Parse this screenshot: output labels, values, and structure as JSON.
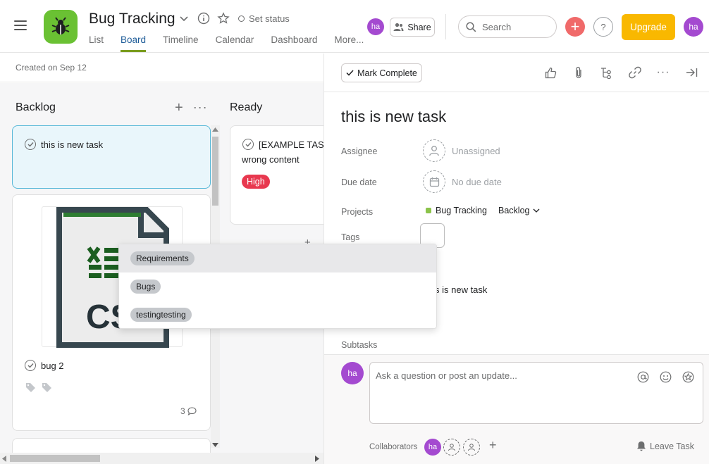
{
  "header": {
    "project_title": "Bug Tracking",
    "set_status": "Set status",
    "tabs": [
      "List",
      "Board",
      "Timeline",
      "Calendar",
      "Dashboard",
      "More..."
    ],
    "active_tab": "Board",
    "user_initials": "ha",
    "share_label": "Share",
    "search_placeholder": "Search",
    "help_label": "?",
    "upgrade_label": "Upgrade",
    "project_icon": "bug-icon",
    "colors": {
      "accent": "#6ac133",
      "upgrade": "#f9b800",
      "add": "#f06a6a",
      "avatar": "#a44ad0"
    }
  },
  "board": {
    "created": "Created on Sep 12",
    "columns": [
      {
        "title": "Backlog"
      },
      {
        "title": "Ready"
      }
    ],
    "backlog_cards": [
      {
        "title": "this is new task"
      },
      {
        "title": "bug 2",
        "comment_count": "3",
        "attachment_text": "CS"
      }
    ],
    "ready_cards": [
      {
        "title_line1": "[EXAMPLE TASK",
        "title_line2": "wrong content",
        "priority": "High",
        "priority_color": "#e8384f"
      }
    ]
  },
  "tag_dropdown": {
    "options": [
      "Requirements",
      "Bugs",
      "testingtesting"
    ]
  },
  "task_panel": {
    "mark_complete": "Mark Complete",
    "title": "this is new task",
    "fields": {
      "assignee_label": "Assignee",
      "assignee_value": "Unassigned",
      "due_label": "Due date",
      "due_value": "No due date",
      "projects_label": "Projects",
      "project_name": "Bug Tracking",
      "section_name": "Backlog",
      "tags_label": "Tags"
    },
    "description_fragment": "s is new task",
    "subtasks_label": "Subtasks",
    "comment_placeholder": "Ask a question or post an update...",
    "collaborators_label": "Collaborators",
    "leave_task": "Leave Task"
  }
}
